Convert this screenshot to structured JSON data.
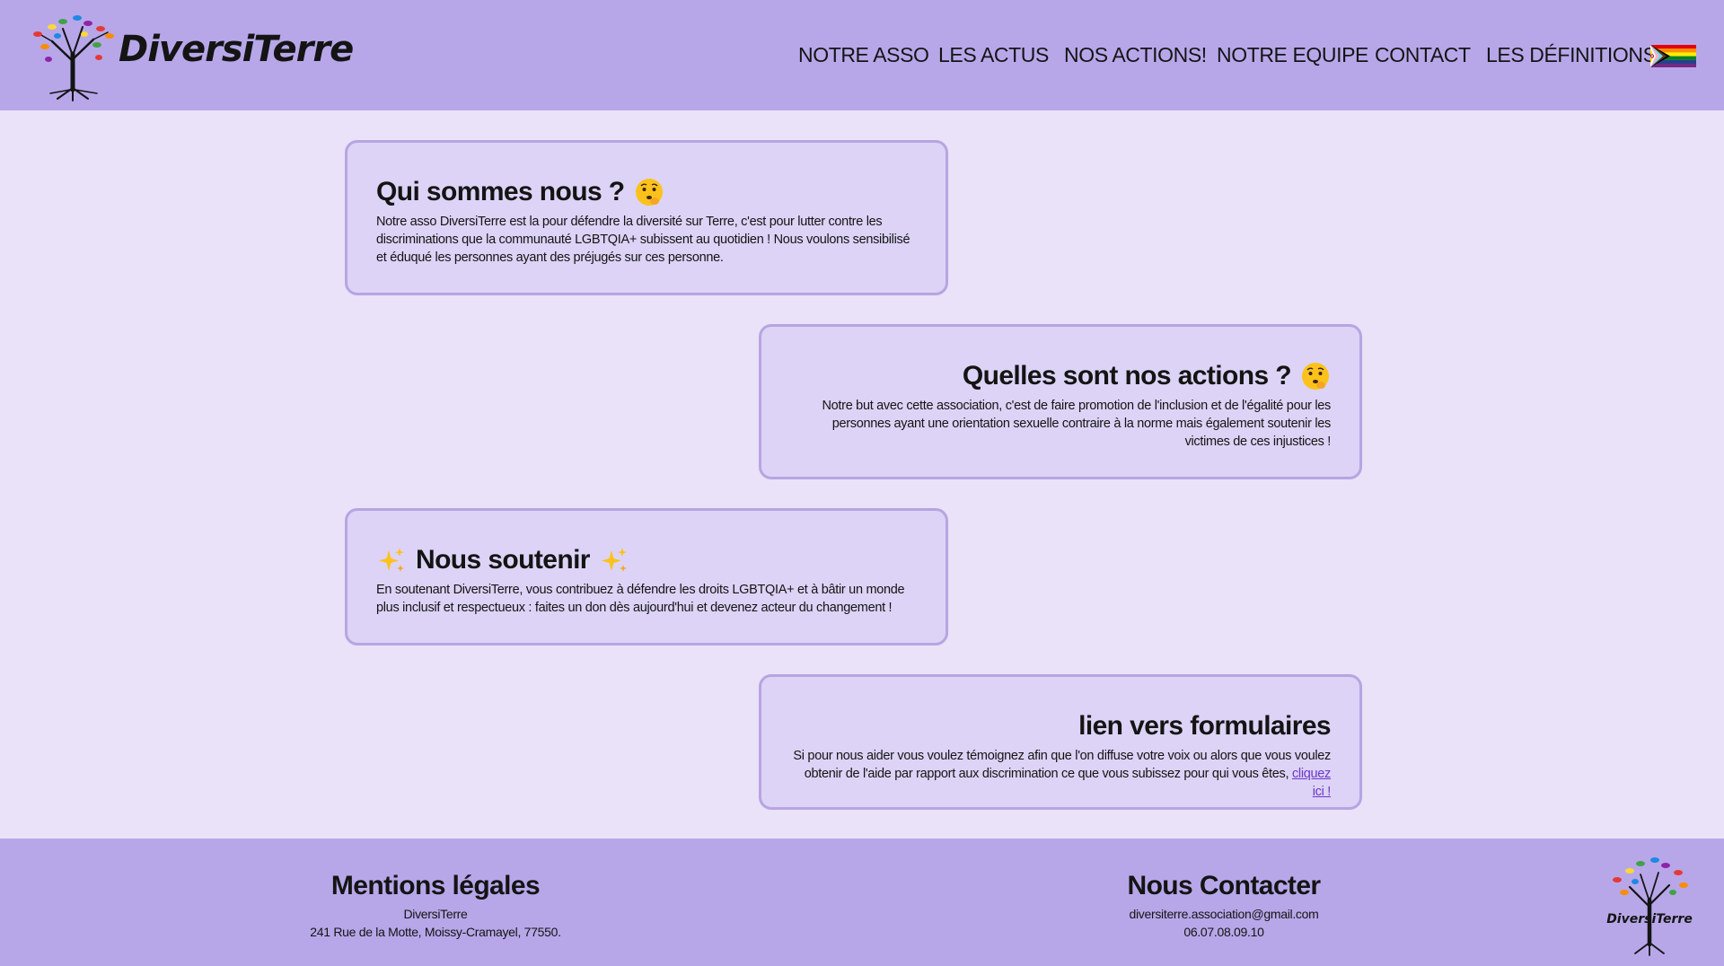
{
  "header": {
    "brand": "DiversiTerre",
    "nav": [
      {
        "label": "NOTRE ASSO"
      },
      {
        "label": "LES ACTUS"
      },
      {
        "label": "NOS ACTIONS!"
      },
      {
        "label": "NOTRE EQUIPE"
      },
      {
        "label": "CONTACT"
      },
      {
        "label": "LES DÉFINITIONS"
      }
    ],
    "flag_icon": "progress-pride-flag-icon"
  },
  "cards": [
    {
      "title": "Qui sommes nous ?",
      "title_icon": "thinking-face-icon",
      "text": "Notre asso DiversiTerre est la pour défendre la diversité sur Terre, c'est pour lutter contre les discriminations que la communauté LGBTQIA+ subissent au quotidien ! Nous voulons sensibilisé et éduqué les personnes ayant des préjugés sur ces personne."
    },
    {
      "title": "Quelles sont nos actions ?",
      "title_icon": "thinking-face-icon",
      "text": "Notre but avec cette association, c'est de faire promotion de l'inclusion et de l'égalité pour les personnes ayant une orientation sexuelle contraire à la norme mais également soutenir les victimes de ces injustices !"
    },
    {
      "title": "Nous soutenir",
      "title_icon": "sparkles-icon",
      "text": "En soutenant DiversiTerre, vous contribuez à défendre les droits LGBTQIA+ et à bâtir un monde plus inclusif et respectueux : faites un don dès aujourd'hui et devenez acteur du changement !"
    },
    {
      "title": "lien vers formulaires",
      "text": "Si pour nous aider vous voulez témoignez afin que l'on diffuse votre voix ou alors que vous voulez obtenir de l'aide par rapport aux discrimination ce que vous subissez pour qui vous êtes,",
      "link_label": "cliquez ici !"
    }
  ],
  "footer": {
    "legal_title": "Mentions légales",
    "legal_name": "DiversiTerre",
    "legal_address": "241 Rue de la Motte, Moissy-Cramayel, 77550.",
    "contact_title": "Nous Contacter",
    "contact_email": "diversiterre.association@gmail.com",
    "contact_phone": "06.07.08.09.10",
    "logo_text": "DiversiTerre"
  },
  "colors": {
    "header_bg": "#b7a7e9",
    "page_bg": "#e9e2f8",
    "card_bg": "#ddd3f6",
    "card_border": "#b6a5e2",
    "link": "#6a39c8"
  }
}
